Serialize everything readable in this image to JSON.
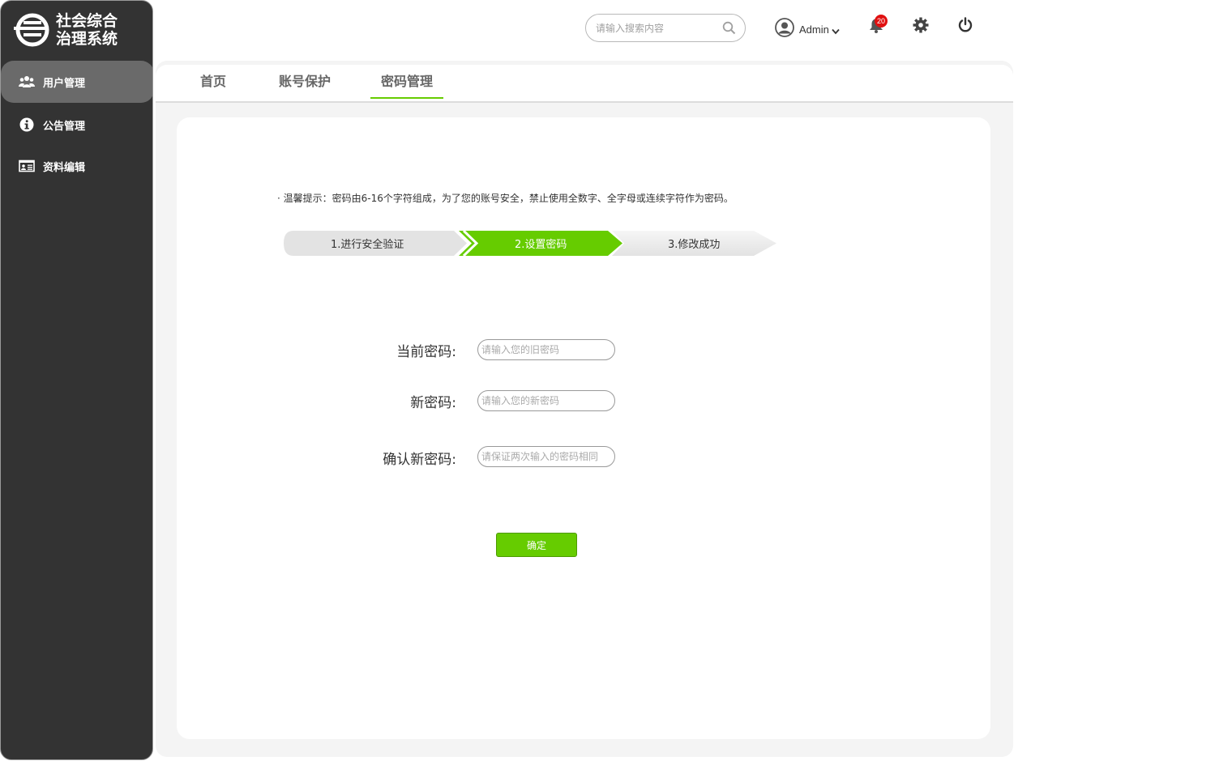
{
  "app": {
    "logo_line1": "社会综合",
    "logo_line2": "治理系统"
  },
  "sidebar": {
    "items": [
      {
        "label": "用户管理",
        "icon": "users-icon",
        "active": true
      },
      {
        "label": "公告管理",
        "icon": "info-icon",
        "active": false
      },
      {
        "label": "资料编辑",
        "icon": "id-card-icon",
        "active": false
      }
    ]
  },
  "header": {
    "search_placeholder": "请输入搜索内容",
    "user_name": "Admin",
    "notification_count": "20"
  },
  "tabs": [
    {
      "label": "首页",
      "active": false
    },
    {
      "label": "账号保护",
      "active": false
    },
    {
      "label": "密码管理",
      "active": true
    }
  ],
  "tip": "· 温馨提示：密码由6-16个字符组成，为了您的账号安全，禁止使用全数字、全字母或连续字符作为密码。",
  "steps": [
    {
      "label": "1.进行安全验证",
      "status": "done"
    },
    {
      "label": "2.设置密码",
      "status": "current"
    },
    {
      "label": "3.修改成功",
      "status": "pending"
    }
  ],
  "form": {
    "current_label": "当前密码:",
    "current_placeholder": "请输入您的旧密码",
    "new_label": "新密码:",
    "new_placeholder": "请输入您的新密码",
    "confirm_label": "确认新密码:",
    "confirm_placeholder": "请保证两次输入的密码相同",
    "submit_label": "确定"
  },
  "colors": {
    "sidebar_bg": "#333333",
    "sidebar_active": "#6a6a6a",
    "accent_green": "#66cc00",
    "badge_red": "#e01010"
  }
}
